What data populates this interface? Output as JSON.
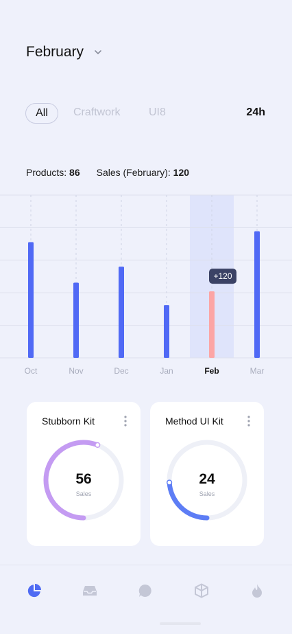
{
  "header": {
    "month": "February",
    "dropdown_icon": "chevron-down-icon"
  },
  "filters": {
    "items": [
      "All",
      "Craftwork",
      "UI8"
    ],
    "active": "All",
    "period": "24h"
  },
  "stats": {
    "products_label": "Products:",
    "products_value": "86",
    "sales_label": "Sales (February):",
    "sales_value": "120"
  },
  "chart_data": {
    "type": "bar",
    "categories": [
      "Oct",
      "Nov",
      "Dec",
      "Jan",
      "Feb",
      "Mar"
    ],
    "values": [
      160,
      104,
      126,
      73,
      92,
      175
    ],
    "highlight": "Feb",
    "tooltip": "+120",
    "ylim": [
      0,
      225
    ],
    "grid": true,
    "colors": {
      "bar": "#5069f5",
      "highlight_bar": "#fca5a5",
      "highlight_band": "#dfe4fb",
      "tooltip_bg": "#3b4265"
    }
  },
  "cards": [
    {
      "title": "Stubborn Kit",
      "value": "56",
      "label": "Sales",
      "progress": 0.56,
      "color": "#c49bf2",
      "menu_icon": "more-vertical-icon"
    },
    {
      "title": "Method UI Kit",
      "value": "24",
      "label": "Sales",
      "progress": 0.24,
      "color": "#5d7df5",
      "menu_icon": "more-vertical-icon"
    }
  ],
  "tabbar": {
    "items": [
      "chart-pie-icon",
      "inbox-icon",
      "chat-icon",
      "box-icon",
      "fire-icon"
    ],
    "active": "chart-pie-icon",
    "active_color": "#4f6bf3",
    "inactive_color": "#c4c7d6"
  }
}
